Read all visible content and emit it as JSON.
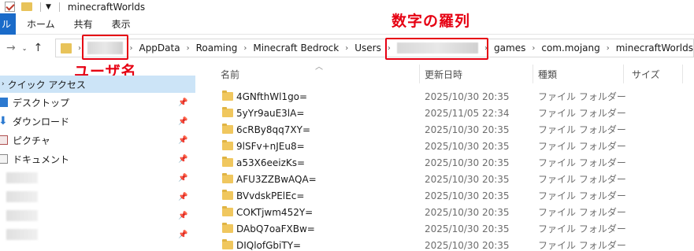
{
  "window": {
    "title": "minecraftWorlds"
  },
  "ribbon": {
    "file_label": "ル",
    "tabs": [
      "ホーム",
      "共有",
      "表示"
    ]
  },
  "breadcrumb": [
    "AppData",
    "Roaming",
    "Minecraft Bedrock",
    "Users",
    "games",
    "com.mojang",
    "minecraftWorlds"
  ],
  "annotations": {
    "username": "ユーザ名",
    "numbers": "数字の羅列",
    "color": "#e60012"
  },
  "sidebar": {
    "quick_access": "クイック アクセス",
    "items": [
      {
        "label": "デスクトップ",
        "icon": "desktop-icon"
      },
      {
        "label": "ダウンロード",
        "icon": "download-icon"
      },
      {
        "label": "ピクチャ",
        "icon": "pictures-icon"
      },
      {
        "label": "ドキュメント",
        "icon": "documents-icon"
      }
    ]
  },
  "columns": {
    "name": "名前",
    "date": "更新日時",
    "type": "種類",
    "size": "サイズ"
  },
  "files": [
    {
      "name": "4GNfthWl1go=",
      "date": "2025/10/30 20:35",
      "type": "ファイル フォルダー"
    },
    {
      "name": "5yYr9auE3lA=",
      "date": "2025/11/05 22:34",
      "type": "ファイル フォルダー"
    },
    {
      "name": "6cRBy8qq7XY=",
      "date": "2025/10/30 20:35",
      "type": "ファイル フォルダー"
    },
    {
      "name": "9lSFv+nJEu8=",
      "date": "2025/10/30 20:35",
      "type": "ファイル フォルダー"
    },
    {
      "name": "a53X6eeizKs=",
      "date": "2025/10/30 20:35",
      "type": "ファイル フォルダー"
    },
    {
      "name": "AFU3ZZBwAQA=",
      "date": "2025/10/30 20:35",
      "type": "ファイル フォルダー"
    },
    {
      "name": "BVvdskPElEc=",
      "date": "2025/10/30 20:35",
      "type": "ファイル フォルダー"
    },
    {
      "name": "COKTjwm452Y=",
      "date": "2025/10/30 20:35",
      "type": "ファイル フォルダー"
    },
    {
      "name": "DAbQ7oaFXBw=",
      "date": "2025/10/30 20:35",
      "type": "ファイル フォルダー"
    },
    {
      "name": "DIQlofGbiTY=",
      "date": "2025/10/30 20:35",
      "type": "ファイル フォルダー"
    }
  ]
}
